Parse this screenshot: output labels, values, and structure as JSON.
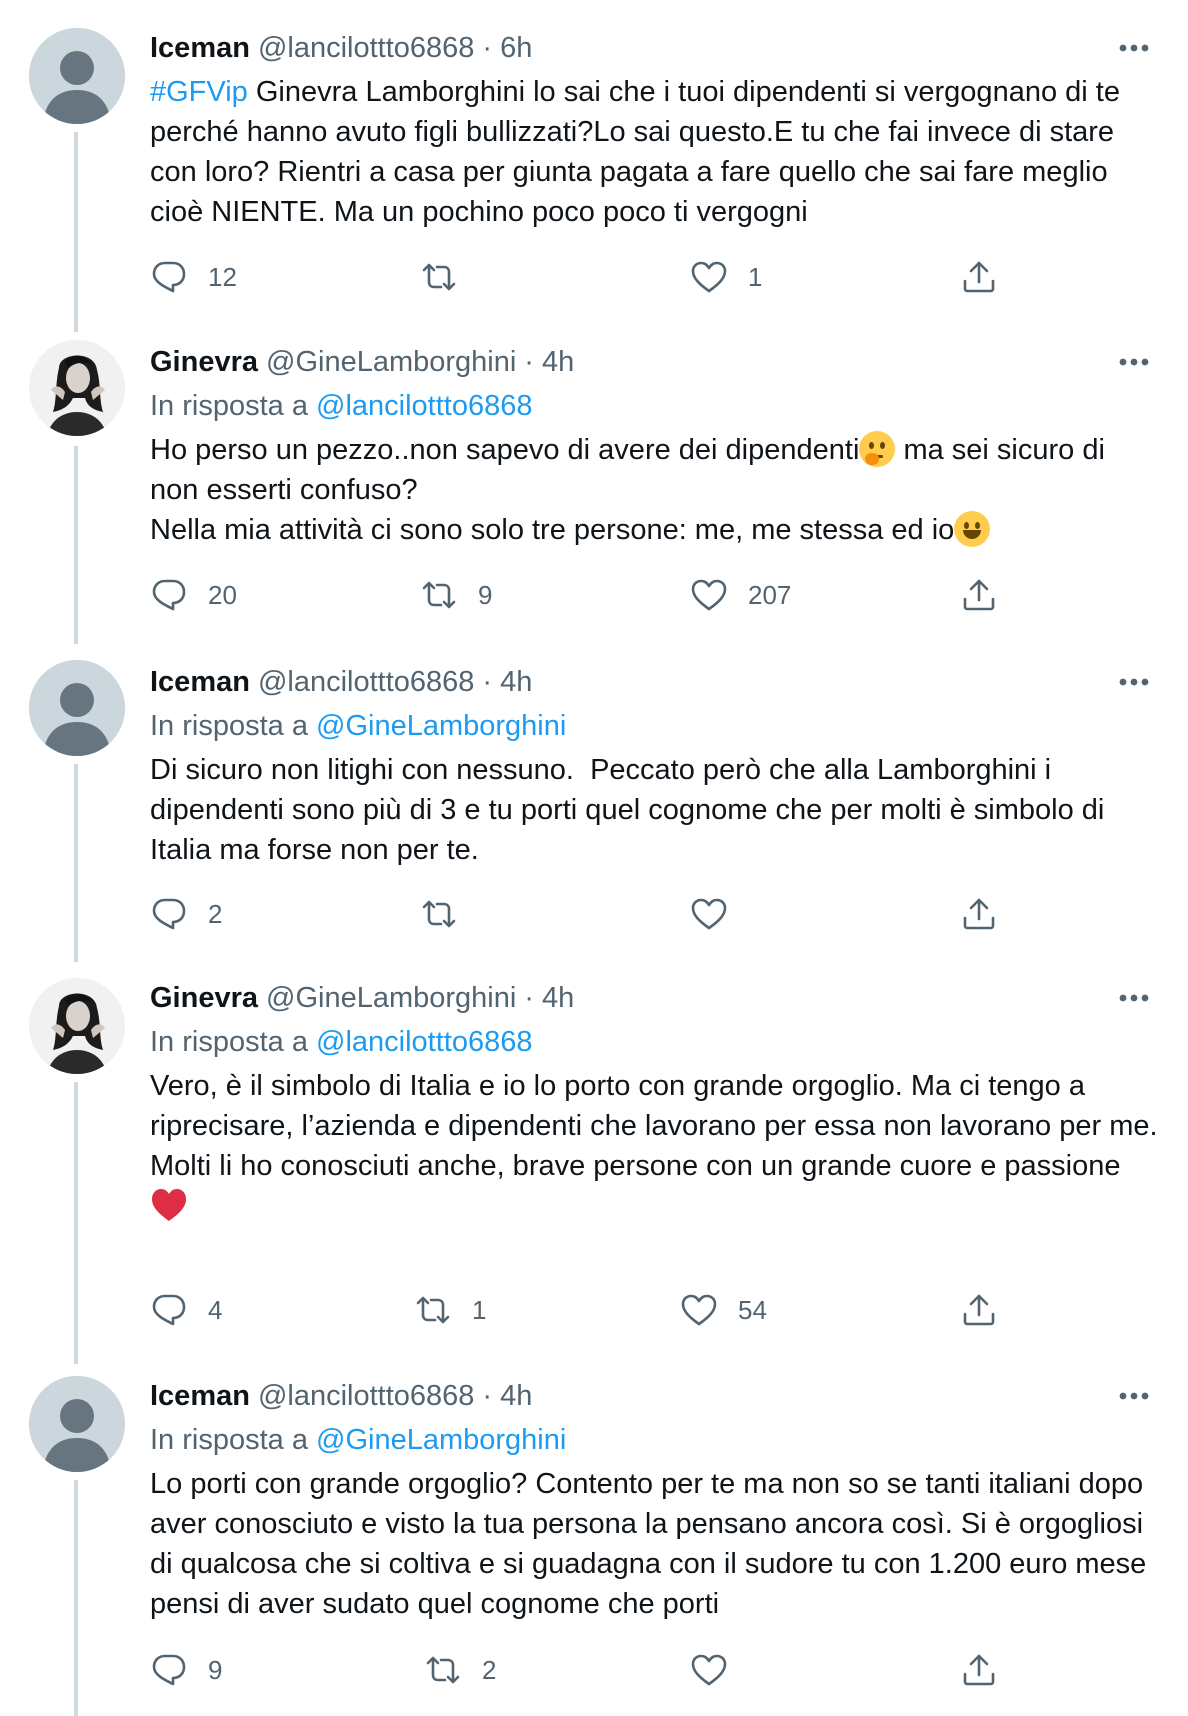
{
  "thread": {
    "tweets": [
      {
        "name": "Iceman",
        "handle": "@lancilottto6868",
        "separator": "·",
        "time": "6h",
        "replying_prefix": "",
        "replying_to": "",
        "hashtag": "#GFVip",
        "text": " Ginevra Lamborghini lo sai che i tuoi dipendenti si vergognano di te perché hanno avuto figli bullizzati?Lo sai questo.E tu che fai invece di stare con loro? Rientri a casa per giunta pagata a fare quello che sai fare meglio cioè NIENTE. Ma un pochino poco poco ti vergogni",
        "replies": "12",
        "retweets": "",
        "likes": "1"
      },
      {
        "name": "Ginevra",
        "handle": "@GineLamborghini",
        "separator": "·",
        "time": "4h",
        "replying_prefix": "In risposta a ",
        "replying_to": "@lancilottto6868",
        "text_1": "Ho perso un pezzo..non sapevo di avere dei dipendenti",
        "emoji_1": "thinking-face",
        "text_2": " ma sei sicuro di non esserti confuso?\nNella mia attività ci sono solo tre persone: me, me stessa ed io",
        "emoji_2": "grinning-face",
        "replies": "20",
        "retweets": "9",
        "likes": "207"
      },
      {
        "name": "Iceman",
        "handle": "@lancilottto6868",
        "separator": "·",
        "time": "4h",
        "replying_prefix": "In risposta a ",
        "replying_to": "@GineLamborghini",
        "text": "Di sicuro non litighi con nessuno.  Peccato però che alla Lamborghini i dipendenti sono più di 3 e tu porti quel cognome che per molti è simbolo di Italia ma forse non per te.",
        "replies": "2",
        "retweets": "",
        "likes": ""
      },
      {
        "name": "Ginevra",
        "handle": "@GineLamborghini",
        "separator": "·",
        "time": "4h",
        "replying_prefix": "In risposta a ",
        "replying_to": "@lancilottto6868",
        "text": "Vero, è il simbolo di Italia e io lo porto con grande orgoglio. Ma ci tengo a riprecisare, l’azienda e dipendenti che lavorano per essa non lavorano per me.\nMolti li ho conosciuti anche, brave persone con un grande cuore e passione",
        "emoji": "red-heart",
        "replies": "4",
        "retweets": "1",
        "likes": "54"
      },
      {
        "name": "Iceman",
        "handle": "@lancilottto6868",
        "separator": "·",
        "time": "4h",
        "replying_prefix": "In risposta a ",
        "replying_to": "@GineLamborghini",
        "text": "Lo porti con grande orgoglio? Contento per te ma non so se tanti italiani dopo aver conosciuto e visto la tua persona la pensano ancora così. Si è orgogliosi di qualcosa che si coltiva e si guadagna con il sudore tu con 1.200 euro mese pensi di aver sudato quel cognome che porti",
        "replies": "9",
        "retweets": "2",
        "likes": ""
      }
    ]
  },
  "icons": {
    "avatar_default": "default-profile-icon",
    "more": "more-horizontal-icon",
    "reply": "reply-bubble-icon",
    "retweet": "retweet-icon",
    "like": "heart-outline-icon",
    "share": "share-upload-icon"
  },
  "colors": {
    "text": "#0f1419",
    "secondary": "#536471",
    "link": "#1d9bf0",
    "thread_line": "#cfd9de",
    "default_avatar_bg": "#ccd6dd",
    "default_avatar_fg": "#66757f"
  }
}
